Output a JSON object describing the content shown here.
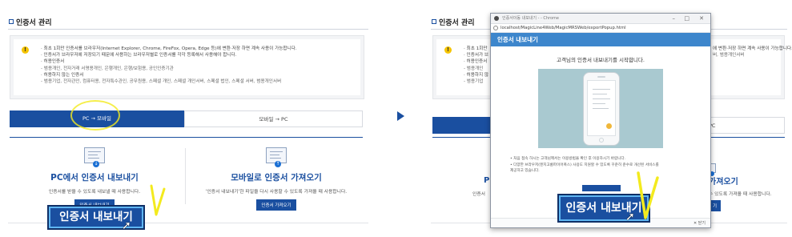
{
  "left": {
    "section_title": "인증서 관리",
    "info_lines": [
      "· 최초 1회만 인증서를 브라우저(Internet Explorer, Chrome, FireFox, Opera, Edge 등)에 변환·저장 하면 계속 사용이 가능합니다.",
      "· 인증서가 브라우저에 저장되기 때문에 사용하는 브라우저별로 인증서를 각각 등록해서 사용해야 합니다.",
      "· 허용인증서",
      "  - 범용개인, 전자거래 서명용개인, 은행개인, 은행/보험용, 공인인증기관",
      "· 허용하지 않는 인증서",
      "  - 범용기업, 전자관인, 컴퓨터용, 전자특수관인, 공무원용, 스페셜 개인, 스페셜 개인서버, 스페셜 법인, 스페셜 서버, 범용개인서버"
    ],
    "tab_active": "PC → 모바일",
    "tab_inactive": "모바일 → PC",
    "feature1": {
      "title": "PC에서 인증서 내보내기",
      "desc": "인증서를 받을 수 있도록 내보낼 때 사용합니다.",
      "button": "인증서 내보내기"
    },
    "feature2": {
      "title": "모바일로 인증서 가져오기",
      "desc": "'인증서 내보내기'한 파일을 다시 사용할 수 있도록 가져올 때 사용합니다.",
      "button": "인증서 가져오기"
    },
    "zoom_button": "인증서 내보내기"
  },
  "right": {
    "section_title": "인증서 관리",
    "info_partial": [
      "· 최초 1회만",
      "· 인증서가 브",
      "· 허용인증서",
      "  - 범용개인",
      "· 허용하지 않",
      "  - 범용기업"
    ],
    "info_right_partial": [
      "에 변환·저장 하면 계속 사용이 가능합니다.",
      "",
      "",
      "",
      "",
      "버, 범용개인서버"
    ],
    "tab_inactive_partial": "PC",
    "feature_partial": {
      "title_left": "P",
      "desc_left": "인증서",
      "title_right": "가져오기",
      "desc_right": "수 있도록 가져올 때 사용합니다.",
      "button_right": "기"
    }
  },
  "popup": {
    "window_title": "인증서이동 내보내기 - - Chrome",
    "url": "localhost/MagicLine4Web/MagicMRSWeb/exportPopup.html",
    "header": "인증서 내보내기",
    "message": "고객님의 인증서 내보내기를 시작합니다.",
    "notes": [
      "• 처음 접속 하시는 고객님께서는 이용방법을 확인 후 이용하시기 바랍니다.",
      "• 다양한 브라우저(엔지고롬파이어폭스) 사용도 지원할 수 있도록 꾸준히 준수로 개선된 서비스를",
      "  제공하고 있습니다."
    ],
    "footer_close": "✕ 닫기",
    "zoom_button": "인증서 내보내기"
  },
  "colors": {
    "primary": "#1a4fa0",
    "popup_header": "#3d86cc",
    "highlight": "#f3ea1e",
    "warning": "#f5c400"
  }
}
